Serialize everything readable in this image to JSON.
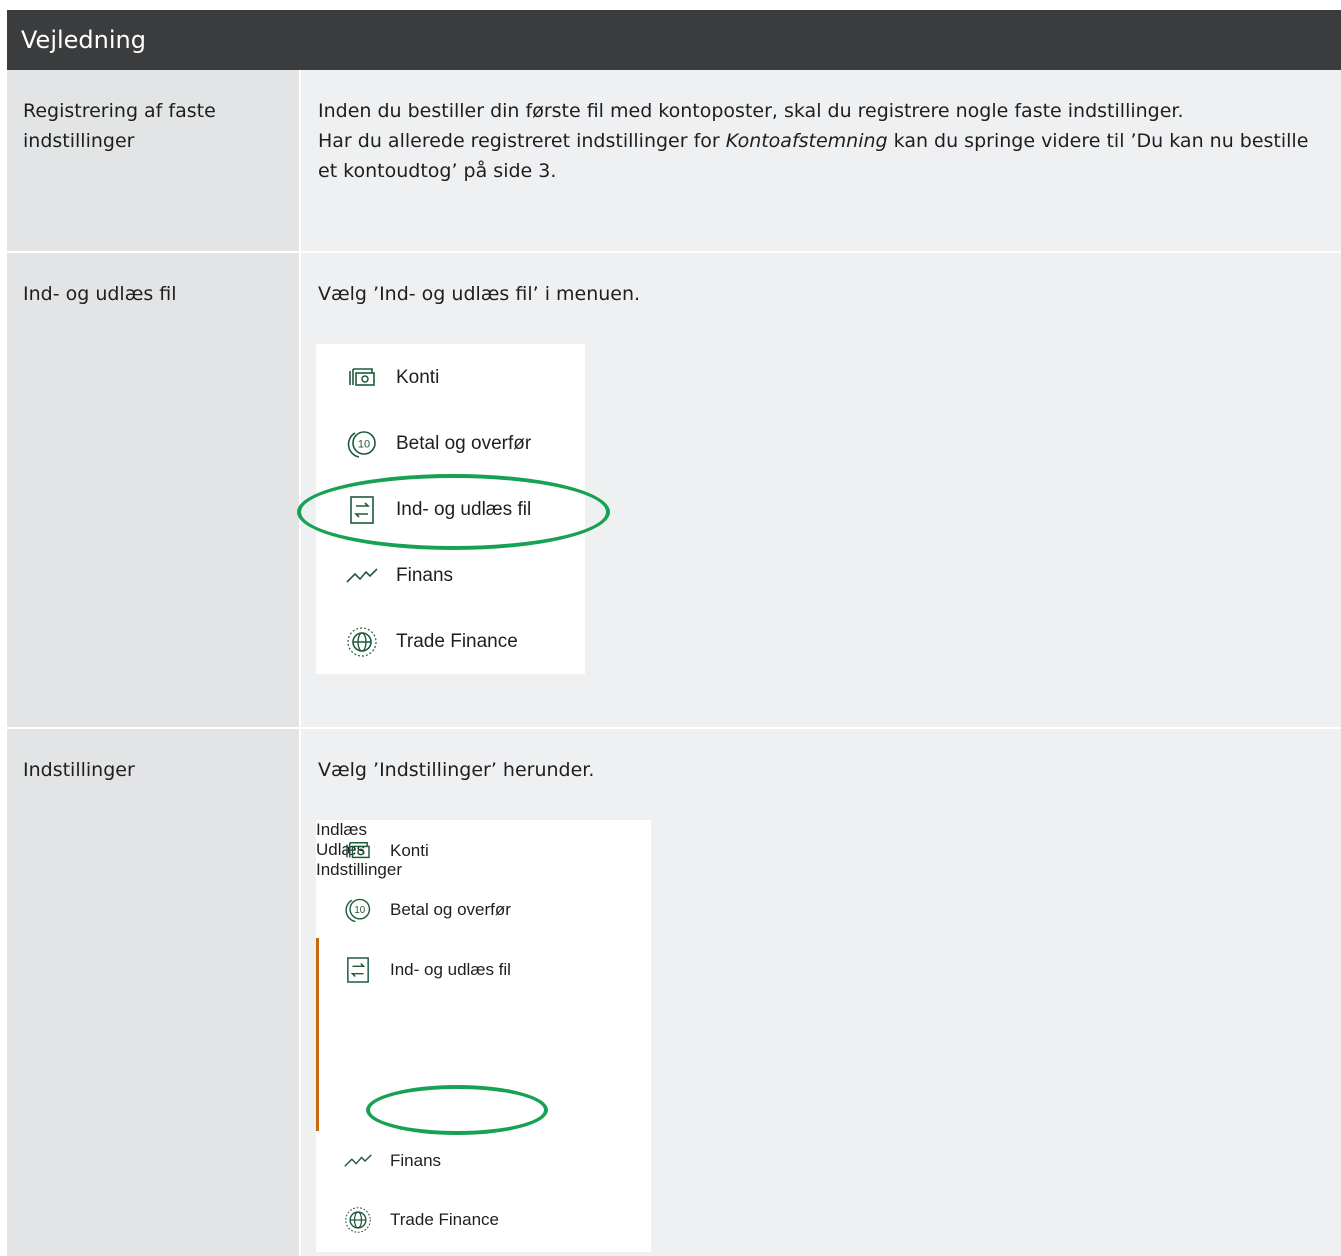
{
  "header": {
    "title": "Vejledning"
  },
  "rows": [
    {
      "label": "Registrering af faste indstillinger",
      "text1": "Inden du bestiller din første fil med kontoposter, skal du registrere nogle faste indstillinger.",
      "text2_prefix": "Har du allerede registreret indstillinger for ",
      "text2_emph": "Kontoafstemning",
      "text2_suffix": " kan du springe videre til ’Du kan nu bestille et kontoudtog’ på side 3."
    },
    {
      "label": "Ind- og udlæs fil",
      "instruction": "Vælg ’Ind- og udlæs fil’ i menuen."
    },
    {
      "label": "Indstillinger",
      "instruction": "Vælg ’Indstillinger’ herunder."
    }
  ],
  "menu": {
    "items": [
      {
        "label": "Konti",
        "icon": "accounts-icon"
      },
      {
        "label": "Betal og overfør",
        "icon": "coin-10-icon"
      },
      {
        "label": "Ind- og udlæs fil",
        "icon": "file-transfer-icon"
      },
      {
        "label": "Finans",
        "icon": "trend-line-icon"
      },
      {
        "label": "Trade Finance",
        "icon": "globe-icon"
      }
    ],
    "subitems": [
      "Indlæs",
      "Udlæs",
      "Indstillinger"
    ]
  },
  "colors": {
    "highlight": "#17a152",
    "active_accent": "#c96a10",
    "active_subitem": "#0c4d33",
    "icon": "#1e5a3a"
  }
}
